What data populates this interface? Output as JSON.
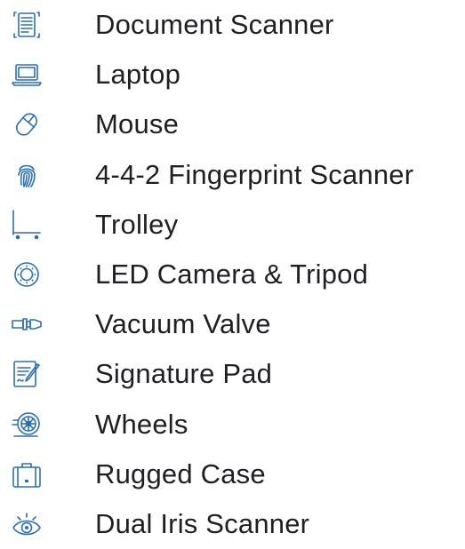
{
  "colors": {
    "icon": "#2b6fb6",
    "text": "#1f1f24",
    "background": "#ffffff"
  },
  "items": [
    {
      "icon": "document-scanner-icon",
      "label": "Document Scanner"
    },
    {
      "icon": "laptop-icon",
      "label": "Laptop"
    },
    {
      "icon": "mouse-icon",
      "label": "Mouse"
    },
    {
      "icon": "fingerprint-icon",
      "label": "4-4-2 Fingerprint Scanner"
    },
    {
      "icon": "trolley-icon",
      "label": "Trolley"
    },
    {
      "icon": "camera-lens-icon",
      "label": "LED Camera & Tripod"
    },
    {
      "icon": "valve-icon",
      "label": "Vacuum Valve"
    },
    {
      "icon": "signature-pad-icon",
      "label": "Signature Pad"
    },
    {
      "icon": "wheel-icon",
      "label": "Wheels"
    },
    {
      "icon": "case-icon",
      "label": "Rugged Case"
    },
    {
      "icon": "eye-scan-icon",
      "label": "Dual Iris Scanner"
    }
  ]
}
